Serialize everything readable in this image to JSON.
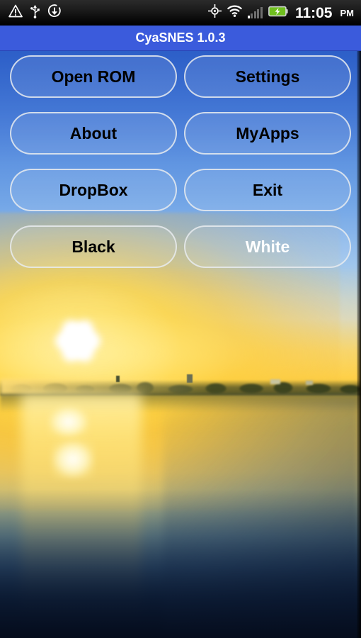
{
  "statusbar": {
    "left_icons": [
      {
        "name": "warning-triangle-icon",
        "label": "warning"
      },
      {
        "name": "usb-icon",
        "label": "usb"
      },
      {
        "name": "download-sync-icon",
        "label": "download"
      }
    ],
    "right_icons": [
      {
        "name": "gps-crosshair-icon",
        "label": "gps"
      },
      {
        "name": "wifi-icon",
        "label": "wifi"
      },
      {
        "name": "cellular-signal-icon",
        "label": "signal",
        "bars_total": 5,
        "bars_active": 1
      },
      {
        "name": "battery-charging-icon",
        "label": "battery charging",
        "color": "#7ed321"
      }
    ],
    "time": "11:05",
    "ampm": "PM"
  },
  "titlebar": {
    "title": "CyaSNES 1.0.3",
    "background_color": "#3b5bdc",
    "text_color": "#ffffff"
  },
  "buttons": [
    {
      "label": "Open ROM",
      "name": "open-rom-button",
      "text_color": "#000000"
    },
    {
      "label": "Settings",
      "name": "settings-button",
      "text_color": "#000000"
    },
    {
      "label": "About",
      "name": "about-button",
      "text_color": "#000000"
    },
    {
      "label": "MyApps",
      "name": "myapps-button",
      "text_color": "#000000"
    },
    {
      "label": "DropBox",
      "name": "dropbox-button",
      "text_color": "#000000"
    },
    {
      "label": "Exit",
      "name": "exit-button",
      "text_color": "#000000"
    },
    {
      "label": "Black",
      "name": "black-button",
      "text_color": "#000000"
    },
    {
      "label": "White",
      "name": "white-button",
      "text_color": "#ffffff"
    }
  ],
  "wallpaper": {
    "description": "Sunset over a lake with starburst sun, tree line silhouette and water reflection",
    "sky_top_color": "#2f60c8",
    "sun_color": "#ffd24d",
    "water_bottom_color": "#081326"
  }
}
